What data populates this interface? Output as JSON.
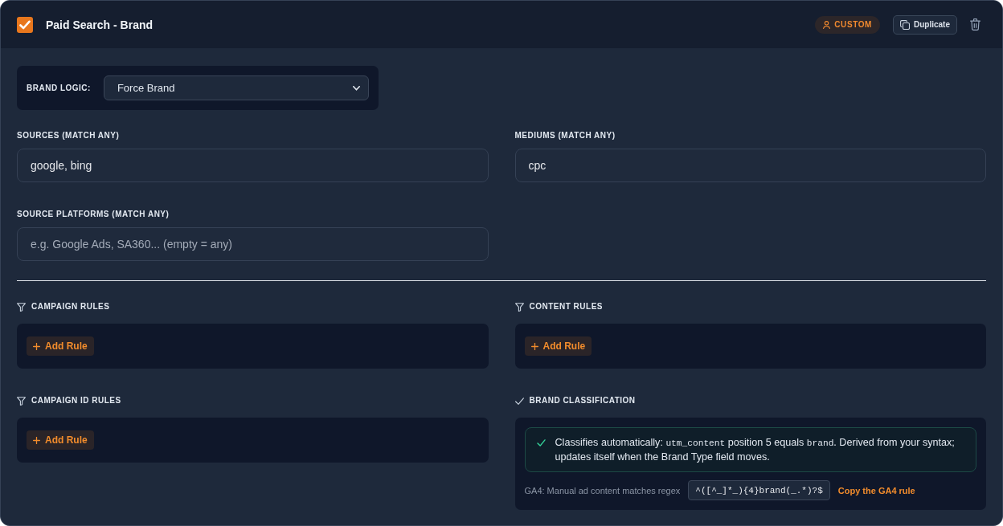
{
  "rule": {
    "enabled": true,
    "title": "Paid Search - Brand"
  },
  "header": {
    "badge": "CUSTOM",
    "duplicate_button": "Duplicate"
  },
  "brand_logic": {
    "label": "BRAND LOGIC:",
    "value": "Force Brand"
  },
  "fields": [
    {
      "label": "SOURCES (MATCH ANY)",
      "value": "google, bing"
    },
    {
      "label": "MEDIUMS (MATCH ANY)",
      "value": "cpc"
    },
    {
      "label": "SOURCE PLATFORMS (MATCH ANY)",
      "placeholder": "e.g. Google Ads, SA360... (empty = any)"
    }
  ],
  "rule_sections": [
    {
      "kind": "rules",
      "title": "CAMPAIGN RULES",
      "add_button": "Add Rule"
    },
    {
      "kind": "rules",
      "title": "CONTENT RULES",
      "add_button": "Add Rule"
    },
    {
      "kind": "rules",
      "title": "CAMPAIGN ID RULES",
      "add_button": "Add Rule"
    },
    {
      "kind": "classification",
      "title": "BRAND CLASSIFICATION",
      "notice": [
        {
          "kind": "text",
          "text": "Classifies automatically: "
        },
        {
          "kind": "code",
          "text": "utm_content"
        },
        {
          "kind": "text",
          "text": " position 5 equals "
        },
        {
          "kind": "code",
          "text": "brand"
        },
        {
          "kind": "text",
          "text": ". Derived from your syntax; updates itself when the Brand Type field moves."
        }
      ],
      "ga4_label": "GA4: Manual ad content matches regex",
      "regex": "^([^_]*_){4}brand(_.*)?$",
      "copy_link": "Copy the GA4 rule"
    }
  ]
}
